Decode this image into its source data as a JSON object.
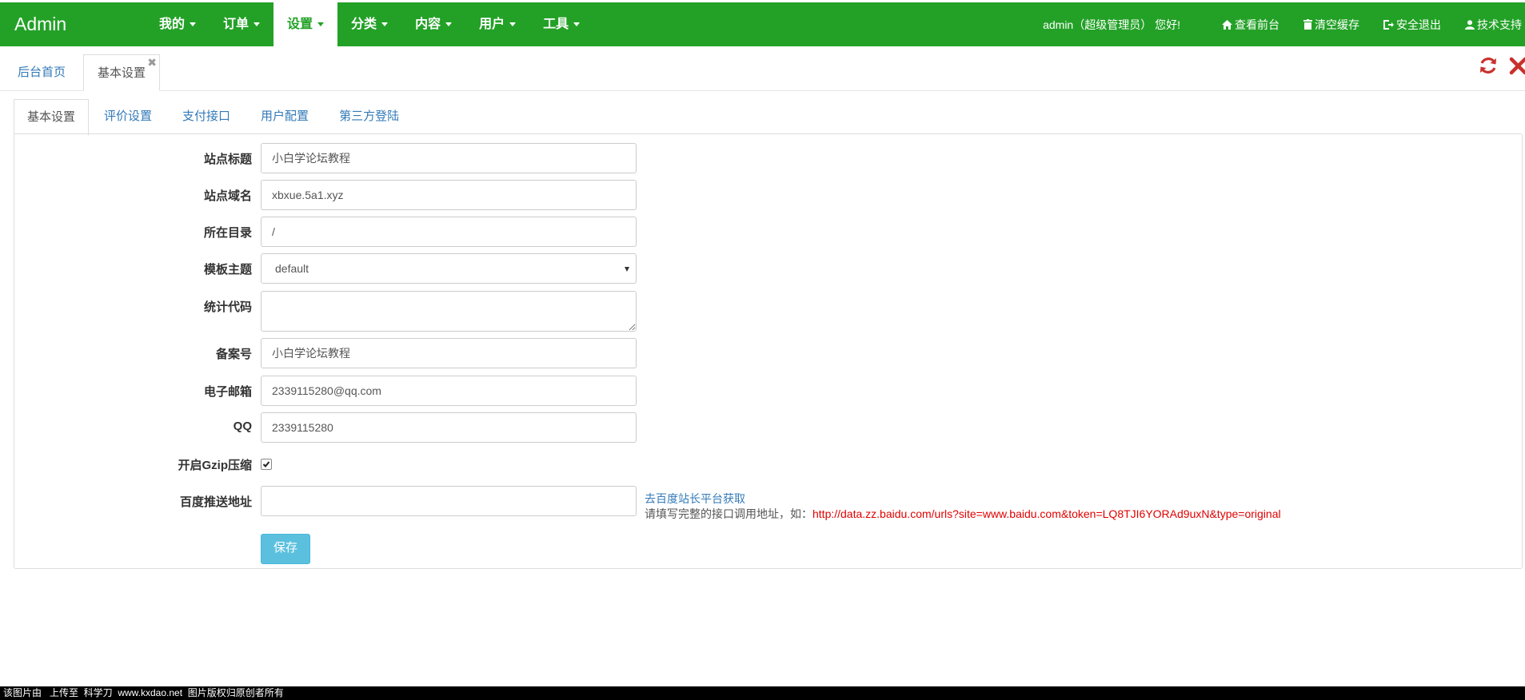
{
  "brand": "Admin",
  "menu": [
    {
      "label": "我的",
      "active": false
    },
    {
      "label": "订单",
      "active": false
    },
    {
      "label": "设置",
      "active": true
    },
    {
      "label": "分类",
      "active": false
    },
    {
      "label": "内容",
      "active": false
    },
    {
      "label": "用户",
      "active": false
    },
    {
      "label": "工具",
      "active": false
    }
  ],
  "header": {
    "welcome": "admin（超级管理员） 您好!",
    "links": [
      "查看前台",
      "清空缓存",
      "安全退出",
      "技术支持"
    ]
  },
  "page_tabs": {
    "home": "后台首页",
    "current": "基本设置",
    "close": "✖"
  },
  "settings_tabs": [
    "基本设置",
    "评价设置",
    "支付接口",
    "用户配置",
    "第三方登陆"
  ],
  "form": {
    "site_title": {
      "label": "站点标题",
      "value": "小白学论坛教程"
    },
    "site_domain": {
      "label": "站点域名",
      "value": "xbxue.5a1.xyz"
    },
    "directory": {
      "label": "所在目录",
      "value": "/"
    },
    "theme": {
      "label": "模板主题",
      "value": "default"
    },
    "stats_code": {
      "label": "统计代码",
      "value": ""
    },
    "icp": {
      "label": "备案号",
      "value": "小白学论坛教程"
    },
    "email": {
      "label": "电子邮箱",
      "value": "2339115280@qq.com"
    },
    "qq": {
      "label": "QQ",
      "value": "2339115280"
    },
    "gzip": {
      "label": "开启Gzip压缩",
      "checked": true
    },
    "baidu_push": {
      "label": "百度推送地址",
      "value": "",
      "help_link": "去百度站长平台获取",
      "help_text": "请填写完整的接口调用地址，如：",
      "help_url": "http://data.zz.baidu.com/urls?site=www.baidu.com&token=LQ8TJI6YORAd9uxN&type=original"
    },
    "save": "保存"
  },
  "footer": "该图片由   上传至  科学刀  www.kxdao.net  图片版权归原创者所有",
  "colors": {
    "nav_green": "#23a127",
    "link_blue": "#337ab7",
    "button": "#5bc0de",
    "red": "#c9302c"
  }
}
